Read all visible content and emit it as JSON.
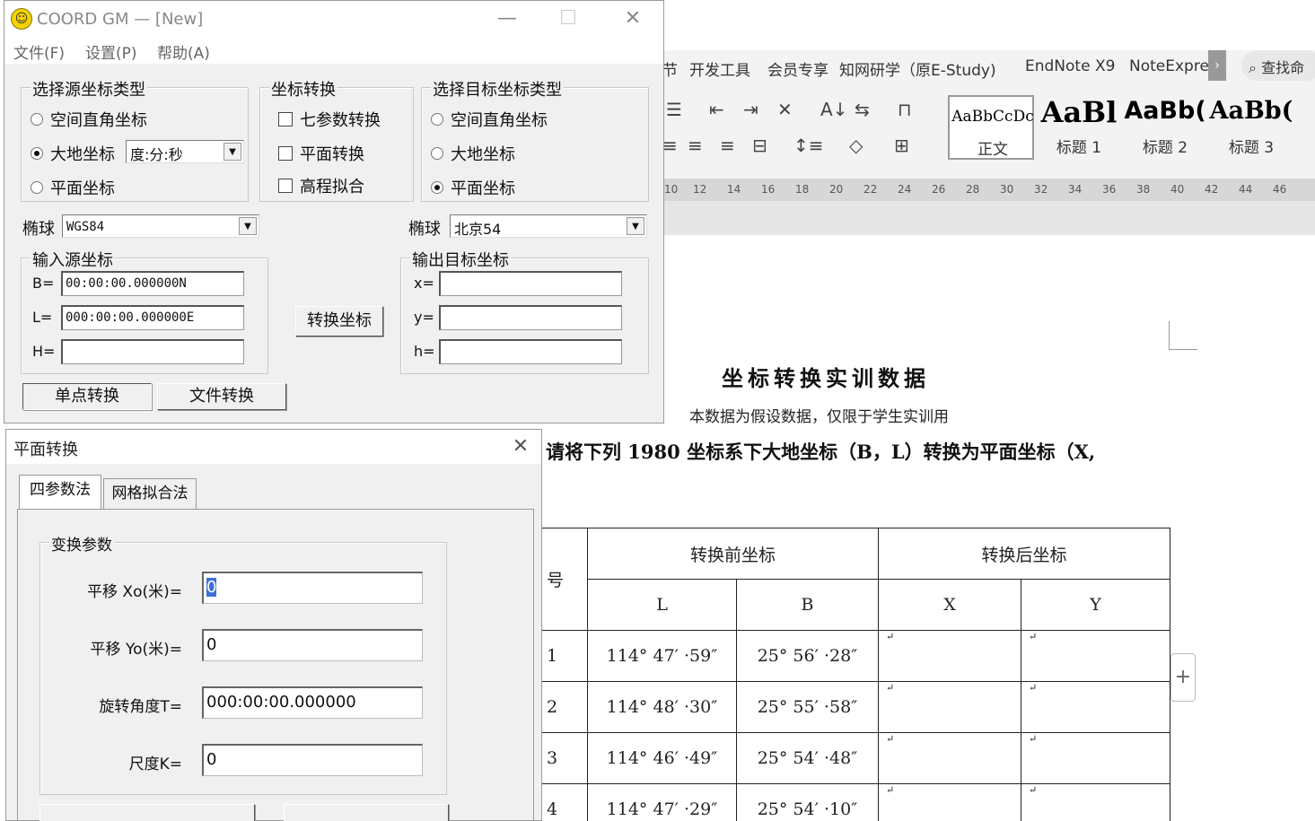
{
  "word": {
    "tabs": [
      "节",
      "开发工具",
      "会员专享",
      "知网研学（原E-Study)",
      "EndNote X9",
      "NoteExpre"
    ],
    "search_placeholder": "查找命",
    "styles": [
      {
        "preview": "AaBbCcDc",
        "label": "正文"
      },
      {
        "preview": "AaBl",
        "label": "标题 1"
      },
      {
        "preview": "AaBb(",
        "label": "标题 2"
      },
      {
        "preview": "AaBb(",
        "label": "标题 3"
      }
    ],
    "ruler": [
      "10",
      "12",
      "14",
      "16",
      "18",
      "20",
      "22",
      "24",
      "26",
      "28",
      "30",
      "32",
      "34",
      "36",
      "38",
      "40",
      "42",
      "44",
      "46"
    ],
    "doc": {
      "title": "坐标转换实训数据",
      "subtitle": "本数据为假设数据，仅限于学生实训用",
      "instruction": "请将下列 1980 坐标系下大地坐标（B，L）转换为平面坐标（X,",
      "table": {
        "col_no": "号",
        "before": "转换前坐标",
        "after": "转换后坐标",
        "h_L": "L",
        "h_B": "B",
        "h_X": "X",
        "h_Y": "Y",
        "rows": [
          {
            "no": "1",
            "L": "114° 47′ ·59″",
            "B": "25° 56′ ·28″"
          },
          {
            "no": "2",
            "L": "114° 48′ ·30″",
            "B": "25° 55′ ·58″"
          },
          {
            "no": "3",
            "L": "114° 46′ ·49″",
            "B": "25° 54′ ·48″"
          },
          {
            "no": "4",
            "L": "114° 47′ ·29″",
            "B": "25° 54′ ·10″"
          }
        ]
      }
    }
  },
  "coord": {
    "title": "COORD GM — [New]",
    "menu": [
      "文件(F)",
      "设置(P)",
      "帮助(A)"
    ],
    "source": {
      "title": "选择源坐标类型",
      "opt1": "空间直角坐标",
      "opt2": "大地坐标",
      "opt3": "平面坐标",
      "format": "度:分:秒",
      "selected": "大地坐标"
    },
    "convert": {
      "title": "坐标转换",
      "opt1": "七参数转换",
      "opt2": "平面转换",
      "opt3": "高程拟合"
    },
    "target": {
      "title": "选择目标坐标类型",
      "opt1": "空间直角坐标",
      "opt2": "大地坐标",
      "opt3": "平面坐标",
      "selected": "平面坐标"
    },
    "ellipsoid_label": "椭球",
    "src_ellipsoid": "WGS84",
    "dst_ellipsoid": "北京54",
    "input": {
      "title": "输入源坐标",
      "B_label": "B=",
      "B_value": "00:00:00.000000N",
      "L_label": "L=",
      "L_value": "000:00:00.000000E",
      "H_label": "H=",
      "H_value": ""
    },
    "output": {
      "title": "输出目标坐标",
      "x_label": "x=",
      "y_label": "y=",
      "h_label": "h=",
      "x_value": "",
      "y_value": "",
      "h_value": ""
    },
    "convert_btn": "转换坐标",
    "single_btn": "单点转换",
    "file_btn": "文件转换"
  },
  "plane": {
    "title": "平面转换",
    "tab1": "四参数法",
    "tab2": "网格拟合法",
    "group": "变换参数",
    "x0_label": "平移 Xo(米)=",
    "x0_value": "0",
    "y0_label": "平移 Yo(米)=",
    "y0_value": "0",
    "rot_label": "旋转角度T=",
    "rot_value": "000:00:00.000000",
    "k_label": "尺度K=",
    "k_value": "0"
  }
}
